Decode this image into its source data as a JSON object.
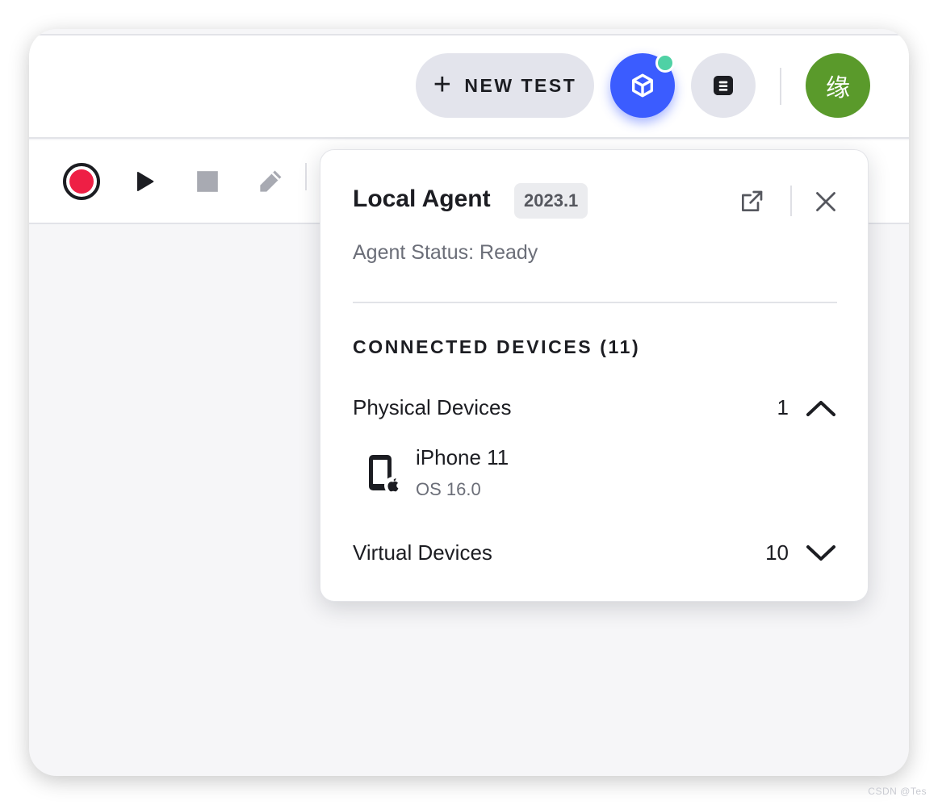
{
  "header": {
    "new_test_plus": "+",
    "new_test_label": "NEW TEST",
    "agent_status_dot_color": "#4fd1a5",
    "avatar_text": "缘",
    "avatar_color": "#5a9a2b"
  },
  "toolbar": {
    "icons": [
      "record-icon",
      "play-icon",
      "stop-icon",
      "pencil-icon"
    ],
    "record_color": "#ee1f45"
  },
  "agent_panel": {
    "title": "Local Agent",
    "version": "2023.1",
    "status": "Agent Status: Ready",
    "section_title": "CONNECTED DEVICES (11)",
    "groups": [
      {
        "label": "Physical Devices",
        "count": "1",
        "expanded": true,
        "devices": [
          {
            "name": "iPhone 11",
            "os": "OS 16.0",
            "icon": "iphone-apple-icon"
          }
        ]
      },
      {
        "label": "Virtual Devices",
        "count": "10",
        "expanded": false,
        "devices": []
      }
    ]
  },
  "watermark": "CSDN @Tes"
}
